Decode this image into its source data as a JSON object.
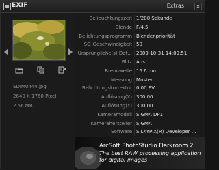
{
  "window": {
    "title": "EXIF",
    "extras_label": "Extras",
    "close_label": "×"
  },
  "preview": {
    "file_name": "SDIM0444.jpg",
    "dimensions": "2640 X 1760 Pixel",
    "file_size": "2.56 MB",
    "icons": [
      "open-folder-icon",
      "copy-icon",
      "export-icon"
    ]
  },
  "exif_rows": [
    {
      "label": "Belieuchtungszeit",
      "value": "1/200 Sekunde"
    },
    {
      "label": "Blende",
      "value": "F/4.5"
    },
    {
      "label": "Belichtungsprogramm",
      "value": "Blendenpriorität"
    },
    {
      "label": "ISO-Geschwindigkeit",
      "value": "50"
    },
    {
      "label": "Ursprüngliche(s) Dat...",
      "value": "2009-10-31 14:09:51"
    },
    {
      "label": "Blitz",
      "value": "Aus"
    },
    {
      "label": "Brennweite",
      "value": "16.6 mm"
    },
    {
      "label": "Messung",
      "value": "Muster"
    },
    {
      "label": "Belichtungskorrektur",
      "value": "0.00 EV"
    },
    {
      "label": "Auflösung(X)",
      "value": "300.00"
    },
    {
      "label": "Auflösung(Y)",
      "value": "300.00"
    },
    {
      "label": "Kameramodell",
      "value": "SIGMA DP1"
    },
    {
      "label": "Kamerahersteller",
      "value": "SIGMA"
    },
    {
      "label": "Software",
      "value": "SILKYPIX(R) Developer ..."
    }
  ],
  "banner": {
    "line1": "ArcSoft PhotoStudio Darkroom 2",
    "line2": "The best RAW processing application",
    "line3": "for digital images"
  },
  "colors": {
    "background": "#1c1c1c",
    "label_text": "#9a9a9a",
    "value_text": "#e2e2e2"
  }
}
